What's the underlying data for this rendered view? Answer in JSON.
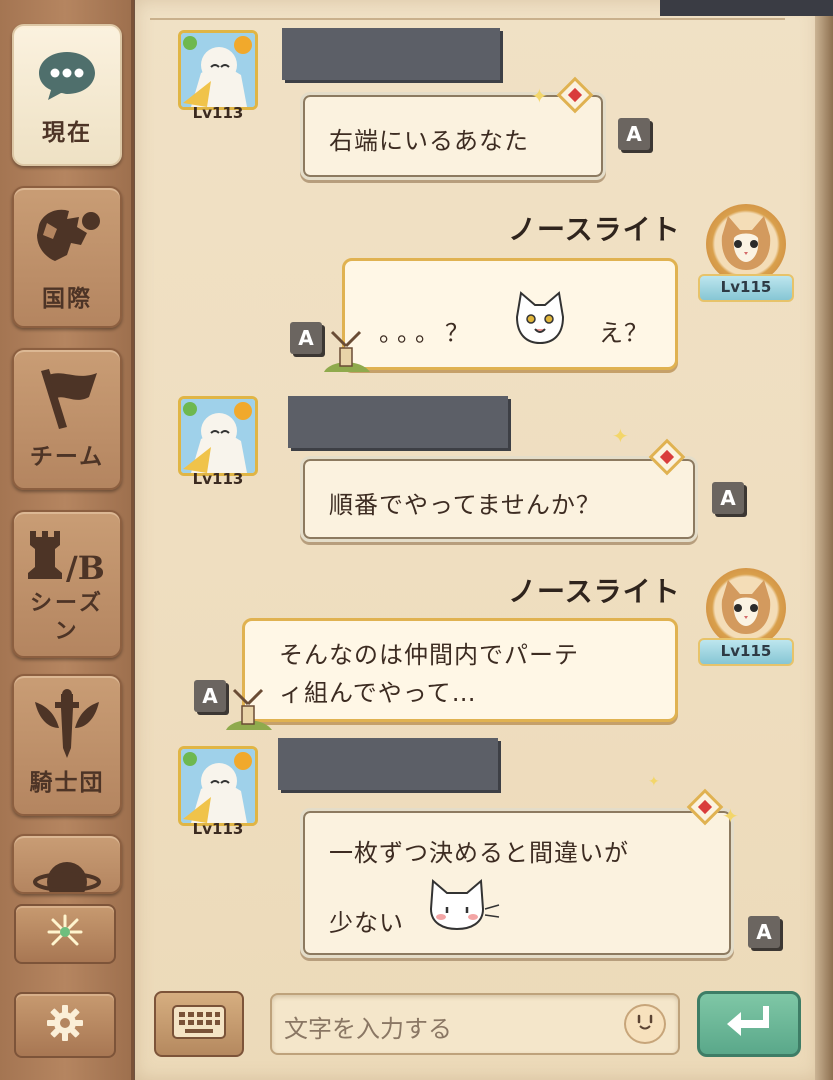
{
  "sidebar": {
    "tabs": [
      {
        "label": "現在",
        "icon": "speech-bubble-icon",
        "active": true
      },
      {
        "label": "国際",
        "icon": "globe-icon",
        "active": false
      },
      {
        "label": "チーム",
        "icon": "flag-icon",
        "active": false
      },
      {
        "label": "シーズン",
        "icon": "chess-rook-icon",
        "active": false,
        "icon_text": "/B"
      },
      {
        "label": "騎士団",
        "icon": "winged-sword-icon",
        "active": false
      }
    ],
    "bottom_buttons": [
      {
        "icon": "firework-icon"
      },
      {
        "icon": "gear-icon"
      }
    ]
  },
  "messages": [
    {
      "side": "left",
      "level": "Lv113",
      "text": "右端にいるあなた",
      "badge": "A"
    },
    {
      "side": "right",
      "name": "ノースライト",
      "level": "Lv115",
      "text_before": "。。。？",
      "text_after": "え？",
      "badge": "A",
      "sticker": "cat-face-icon"
    },
    {
      "side": "left",
      "level": "Lv113",
      "text": "順番でやってませんか？",
      "badge": "A"
    },
    {
      "side": "right",
      "name": "ノースライト",
      "level": "Lv115",
      "line1": "そんなのは仲間内でパーテ",
      "line2": "ィ組んでやって…",
      "badge": "A"
    },
    {
      "side": "left",
      "level": "Lv113",
      "line1": "一枚ずつ決めると間違いが",
      "line2": "少ない",
      "badge": "A",
      "sticker": "blushing-cat-icon"
    }
  ],
  "input": {
    "placeholder": "文字を入力する"
  },
  "colors": {
    "bubble_border": "#e0b251",
    "bubble_bg": "#fff7e6",
    "send_button": "#5aa88a",
    "sidebar": "#a47552"
  }
}
